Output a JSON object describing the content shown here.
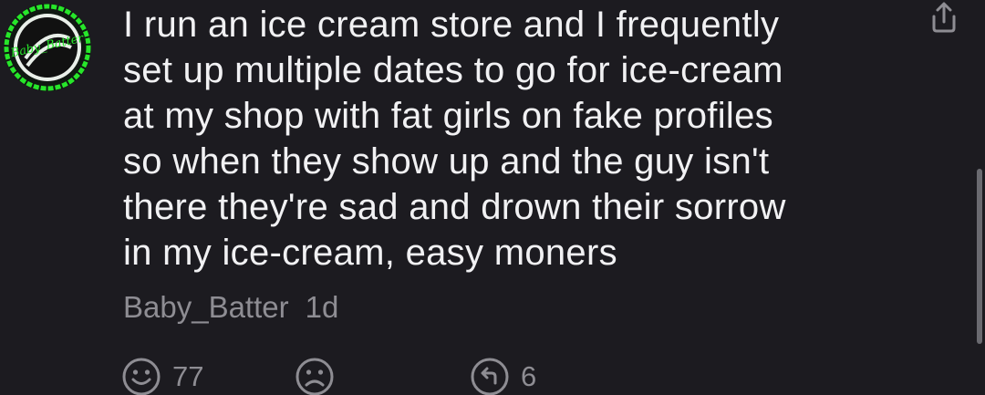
{
  "post": {
    "text": "I run an ice cream store and I frequently\nset up multiple dates to go for ice-cream\nat my shop with fat girls on fake profiles\nso when they show up and the guy isn't\nthere they're sad and drown their sorrow\nin my ice-cream, easy moners",
    "author": "Baby_Batter",
    "age": "1d",
    "avatar_text": "Baby_Batter"
  },
  "actions": {
    "like_count": "77",
    "reply_count": "6",
    "like_icon": "smiley-face-icon",
    "dislike_icon": "sad-face-icon",
    "reply_icon": "reply-arrow-icon",
    "share_icon": "share-icon"
  },
  "colors": {
    "background": "#1c1b20",
    "text": "#f1f1f3",
    "muted": "#8e8d93",
    "avatar_accent": "#27e62a"
  }
}
